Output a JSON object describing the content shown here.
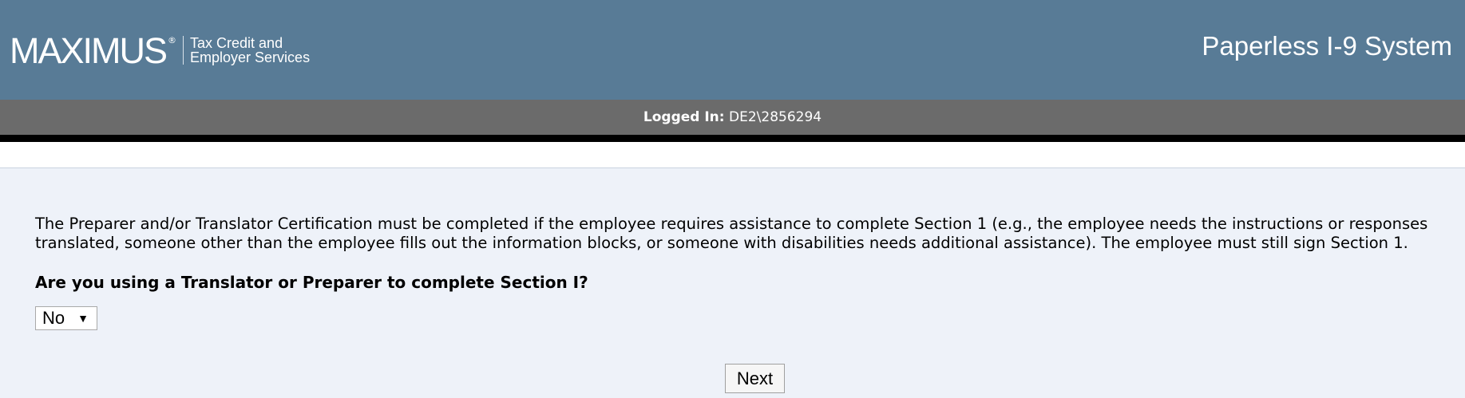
{
  "header": {
    "logo_text": "MAXIMUS",
    "logo_registered": "®",
    "logo_subtitle_line1": "Tax Credit and",
    "logo_subtitle_line2": "Employer Services",
    "app_title": "Paperless I-9 System"
  },
  "status": {
    "label": "Logged In:",
    "user": "DE2\\2856294"
  },
  "main": {
    "description": "The Preparer and/or Translator Certification must be completed if the employee requires assistance to complete Section 1 (e.g., the employee needs the instructions or responses translated, someone other than the employee fills out the information blocks, or someone with disabilities needs additional assistance). The employee must still sign Section 1.",
    "question": "Are you using a Translator or Preparer to complete Section I?",
    "select_value": "No",
    "select_arrow": "▼",
    "next_label": "Next"
  },
  "colors": {
    "header_bg": "#587b96",
    "status_bg": "#6b6b6b",
    "content_bg": "#eef2f9"
  },
  "icons": {
    "dropdown": "dropdown-arrow-icon"
  }
}
